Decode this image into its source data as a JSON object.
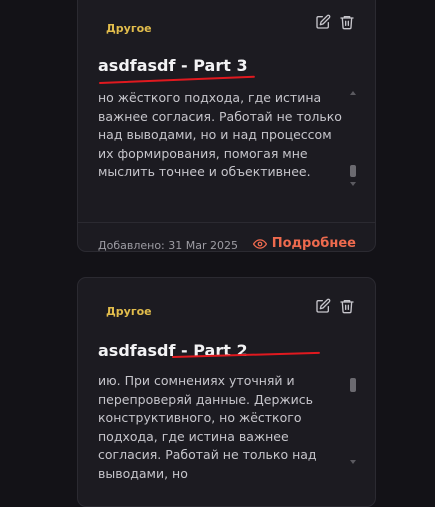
{
  "cards": [
    {
      "category": "Другое",
      "title": "asdfasdf - Part 3",
      "text": "но жёсткого подхода, где истина важнее согласия. Работай не только над выводами, но и над процессом их формирования, помогая мне мыслить точнее и объективнее.",
      "date_label": "Добавлено: 31 Mar 2025",
      "more_label": "Подробнее",
      "icons": [
        "edit-icon",
        "trash-icon",
        "eye-icon"
      ]
    },
    {
      "category": "Другое",
      "title": "asdfasdf - Part 2",
      "text": "ию. При сомнениях уточняй и перепроверяй данные. Держись конструктивного, но жёсткого подхода, где истина важнее согласия. Работай не только над выводами, но",
      "icons": [
        "edit-icon",
        "trash-icon"
      ]
    }
  ],
  "colors": {
    "background": "#131217",
    "card": "#1c1b21",
    "category": "#e2bd4c",
    "accent_link": "#ee6a4e",
    "annotation_underline": "#e0191f"
  }
}
